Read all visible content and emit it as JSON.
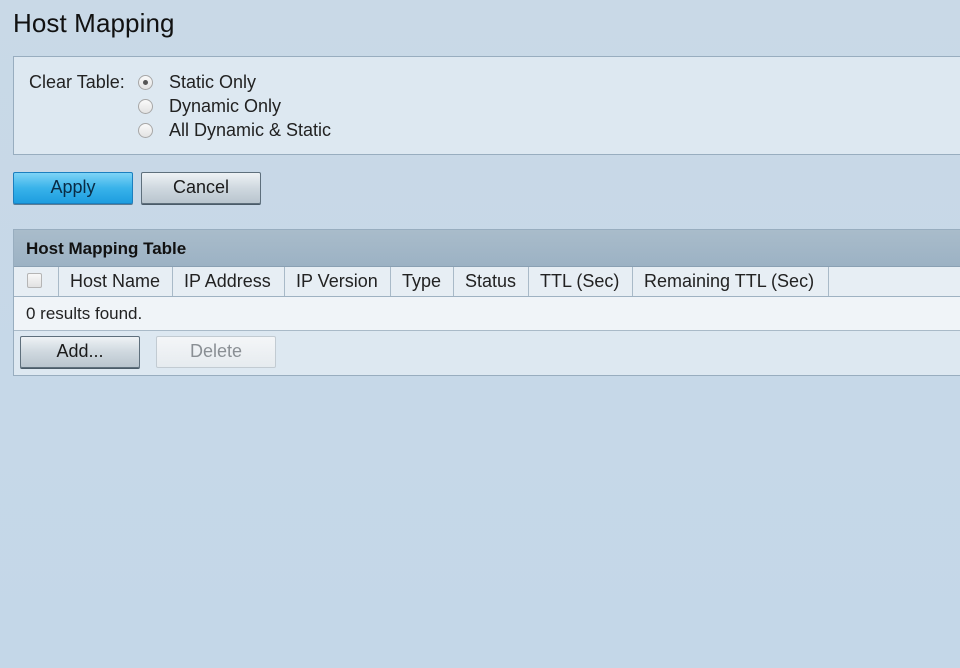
{
  "page": {
    "title": "Host Mapping"
  },
  "clear_table": {
    "label": "Clear Table:",
    "selected": "Static Only",
    "options": [
      {
        "label": "Static Only",
        "checked": true
      },
      {
        "label": "Dynamic Only",
        "checked": false
      },
      {
        "label": "All Dynamic & Static",
        "checked": false
      }
    ]
  },
  "actions": {
    "apply_label": "Apply",
    "cancel_label": "Cancel"
  },
  "table": {
    "caption": "Host Mapping Table",
    "columns": [
      "Host Name",
      "IP Address",
      "IP Version",
      "Type",
      "Status",
      "TTL (Sec)",
      "Remaining TTL (Sec)"
    ],
    "rows": [],
    "results_text": "0 results found.",
    "add_label": "Add...",
    "delete_label": "Delete",
    "delete_enabled": false
  },
  "colors": {
    "background": "#c4d7e8",
    "panel": "#dde8f1",
    "caption_bar": "#9cb2c4",
    "apply_accent": "#39b3ea"
  }
}
